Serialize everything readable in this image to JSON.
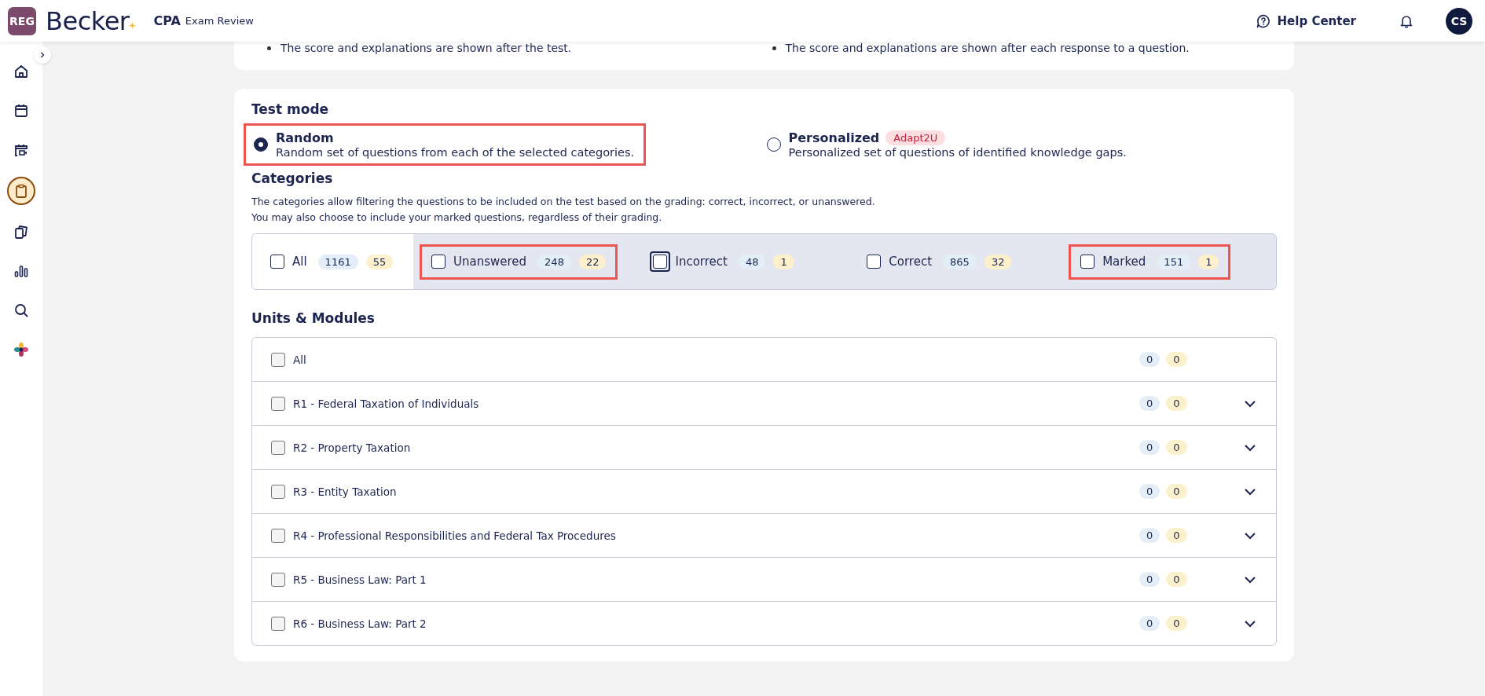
{
  "header": {
    "badge": "REG",
    "logo": "Becker",
    "product": "CPA",
    "product_sub": "Exam Review",
    "help": "Help Center",
    "avatar": "CS"
  },
  "sidebar": {
    "items": [
      {
        "kind": "home",
        "selected": false
      },
      {
        "kind": "calendar",
        "selected": false
      },
      {
        "kind": "video",
        "selected": false
      },
      {
        "kind": "clipboard",
        "selected": true
      },
      {
        "kind": "cards",
        "selected": false
      },
      {
        "kind": "chart",
        "selected": false
      },
      {
        "kind": "search",
        "selected": false
      },
      {
        "kind": "flower",
        "selected": false
      }
    ]
  },
  "feedback_notes": [
    "The score and explanations are shown after the test.",
    "The score and explanations are shown after each response to a question."
  ],
  "test_mode": {
    "title": "Test mode",
    "options": [
      {
        "label": "Random",
        "description": "Random set of questions from each of the selected categories.",
        "selected": true,
        "highlighted": true
      },
      {
        "label": "Personalized",
        "badge": "Adapt2U",
        "description": "Personalized set of questions of identified knowledge gaps.",
        "selected": false,
        "highlighted": false
      }
    ]
  },
  "categories": {
    "title": "Categories",
    "description": [
      "The categories allow filtering the questions to be included on the test based on the grading: correct, incorrect, or unanswered.",
      "You may also choose to include your marked questions, regardless of their grading."
    ],
    "items": [
      {
        "label": "All",
        "count": "1161",
        "count_2": "55",
        "checked": false,
        "focused": false,
        "highlighted": false
      },
      {
        "label": "Unanswered",
        "count": "248",
        "count_2": "22",
        "checked": false,
        "focused": false,
        "highlighted": true
      },
      {
        "label": "Incorrect",
        "count": "48",
        "count_2": "1",
        "checked": false,
        "focused": true,
        "highlighted": false
      },
      {
        "label": "Correct",
        "count": "865",
        "count_2": "32",
        "checked": false,
        "focused": false,
        "highlighted": false
      },
      {
        "label": "Marked",
        "count": "151",
        "count_2": "1",
        "checked": false,
        "focused": false,
        "highlighted": true
      }
    ]
  },
  "units": {
    "title": "Units & Modules",
    "rows": [
      {
        "label": "All",
        "count": "0",
        "count_2": "0",
        "checked": false,
        "expandable": false
      },
      {
        "label": "R1 - Federal Taxation of Individuals",
        "count": "0",
        "count_2": "0",
        "checked": false,
        "expandable": true
      },
      {
        "label": "R2 - Property Taxation",
        "count": "0",
        "count_2": "0",
        "checked": false,
        "expandable": true
      },
      {
        "label": "R3 - Entity Taxation",
        "count": "0",
        "count_2": "0",
        "checked": false,
        "expandable": true
      },
      {
        "label": "R4 - Professional Responsibilities and Federal Tax Procedures",
        "count": "0",
        "count_2": "0",
        "checked": false,
        "expandable": true
      },
      {
        "label": "R5 - Business Law: Part 1",
        "count": "0",
        "count_2": "0",
        "checked": false,
        "expandable": true
      },
      {
        "label": "R6 - Business Law: Part 2",
        "count": "0",
        "count_2": "0",
        "checked": false,
        "expandable": true
      }
    ]
  }
}
